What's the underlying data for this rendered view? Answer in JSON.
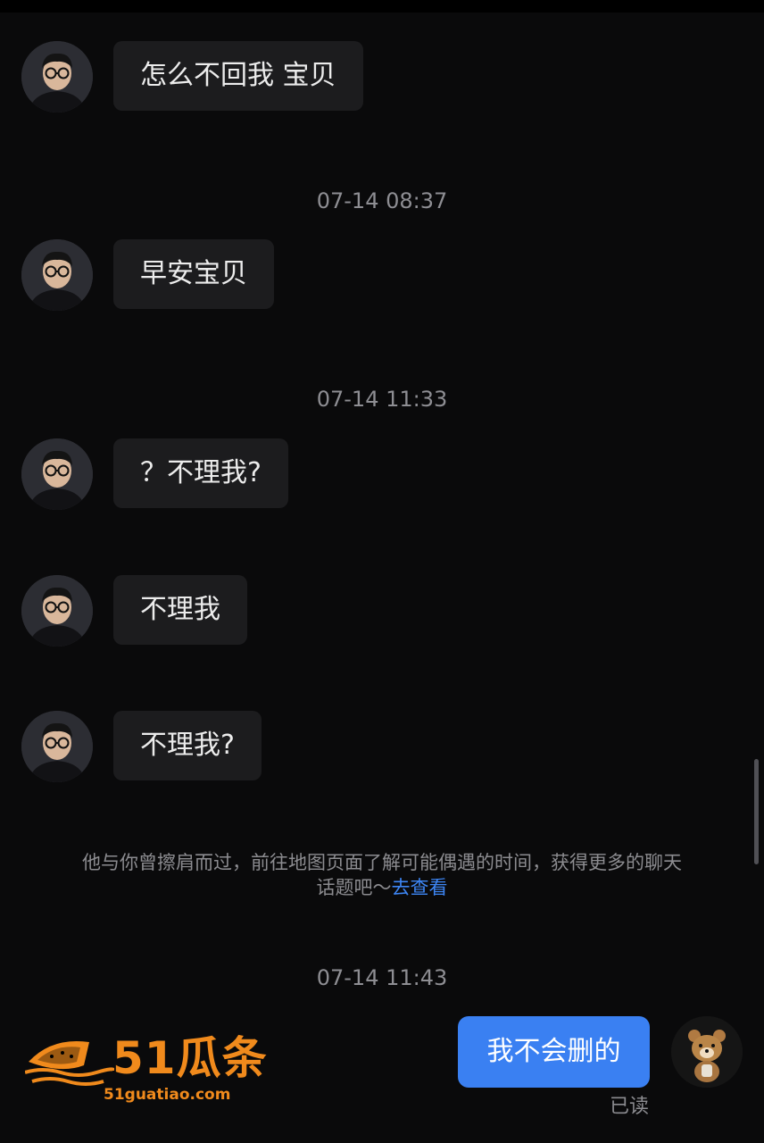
{
  "messages": [
    {
      "text": "怎么不回我 宝贝"
    },
    {
      "text": "早安宝贝"
    },
    {
      "text": "？不理我?"
    },
    {
      "text": "不理我"
    },
    {
      "text": "不理我?"
    }
  ],
  "timestamps": [
    "07-14 08:37",
    "07-14 11:33",
    "07-14 11:43"
  ],
  "tip": {
    "text": "他与你曾擦肩而过，前往地图页面了解可能偶遇的时间，获得更多的聊天话题吧～",
    "link": "去查看"
  },
  "my_message": {
    "text": "我不会删的",
    "status": "已读"
  },
  "watermark": {
    "brand": "51瓜条",
    "domain": "51guatiao.com"
  },
  "colors": {
    "background": "#0a0a0b",
    "incoming_bubble": "#1c1c1e",
    "outgoing_bubble": "#3a80f2",
    "link": "#3d86f5",
    "watermark": "#f08a1c"
  },
  "icons": {
    "contact_avatar": "person-with-glasses-avatar",
    "my_avatar": "bear-avatar"
  }
}
